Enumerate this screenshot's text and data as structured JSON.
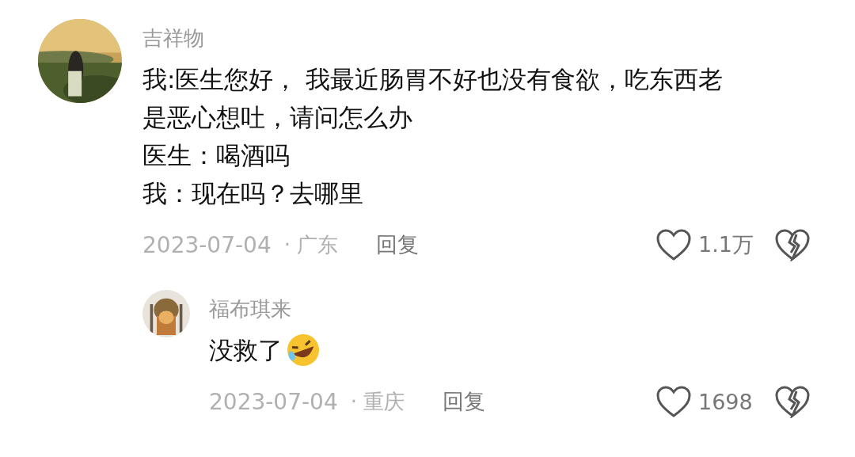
{
  "comments": [
    {
      "kind": "comment",
      "author": "吉祥物",
      "lines": [
        "我:医生您好， 我最近肠胃不好也没有食欲，吃东西老",
        "是恶心想吐，请问怎么办",
        "医生：喝酒吗",
        "我：现在吗？去哪里"
      ],
      "date": "2023-07-04",
      "location": "· 广东",
      "reply": "回复",
      "likes": "1.1万"
    },
    {
      "kind": "reply",
      "author": "福布琪来",
      "lines": [
        "没救了"
      ],
      "emoji": true,
      "date": "2023-07-04",
      "location": "· 重庆",
      "reply": "回复",
      "likes": "1698"
    }
  ]
}
